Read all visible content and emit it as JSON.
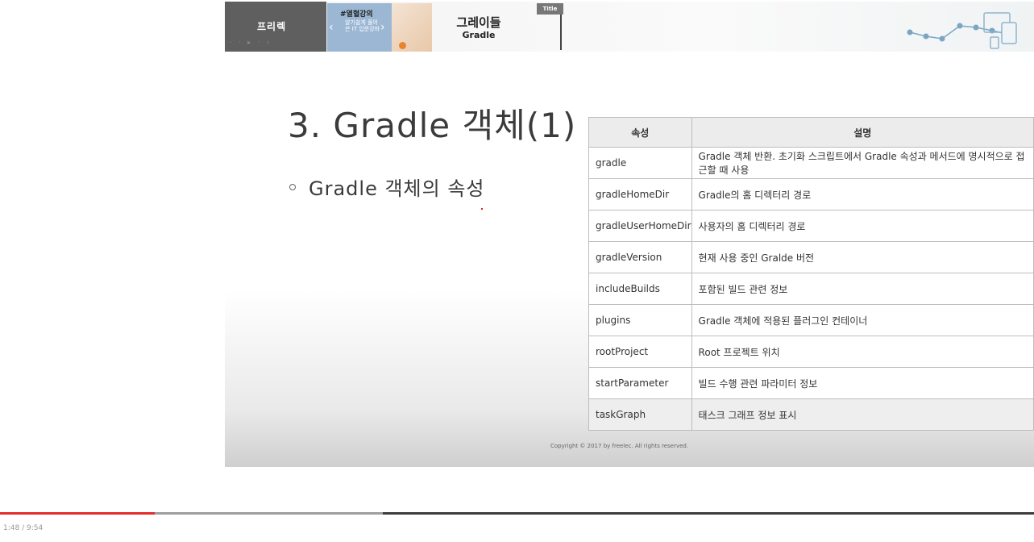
{
  "header": {
    "brand_label": "프리렉",
    "brand_dots": "· · ▸ · ‹",
    "promo_title": "#열혈강의",
    "promo_body": "알기쉽게 풀어쓴 IT 입문강좌",
    "promo_prev": "‹",
    "promo_next": "›",
    "course_kr": "그레이들",
    "course_en": "Gradle",
    "title_tab": "Title"
  },
  "slide": {
    "title": "3. Gradle 객체(1)",
    "bullet": "Gradle 객체의 속성",
    "table": {
      "headers": [
        "속성",
        "설명"
      ],
      "rows": [
        [
          "gradle",
          "Gradle 객체 반환. 초기화 스크립트에서 Gradle 속성과 메서드에 명시적으로 접근할 때 사용"
        ],
        [
          "gradleHomeDir",
          "Gradle의 홈 디렉터리 경로"
        ],
        [
          "gradleUserHomeDir",
          "사용자의 홈 디렉터리 경로"
        ],
        [
          "gradleVersion",
          "현재 사용 중인 Gralde 버전"
        ],
        [
          "includeBuilds",
          "포함된 빌드 관련 정보"
        ],
        [
          "plugins",
          "Gradle 객체에 적용된 플러그인 컨테이너"
        ],
        [
          "rootProject",
          "Root 프로젝트 위치"
        ],
        [
          "startParameter",
          "빌드 수행 관련 파라미터 정보"
        ],
        [
          "taskGraph",
          "태스크 그래프 정보 표시"
        ]
      ]
    },
    "copyright": "Copyright © 2017 by freelec. All rights reserved."
  },
  "player": {
    "time": "1:48 / 9:54",
    "played_fraction": 0.15,
    "buffered_fraction": 0.37,
    "played_color": "#e52b2b"
  }
}
